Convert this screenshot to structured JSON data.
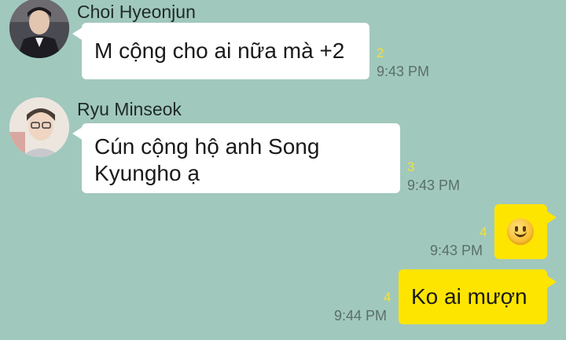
{
  "messages": [
    {
      "sender": "Choi Hyeonjun",
      "text": "M cộng cho ai nữa mà +2",
      "unread": "2",
      "time": "9:43 PM",
      "avatar": "avatar-choi-hyeonjun"
    },
    {
      "sender": "Ryu Minseok",
      "text_line1": "Cún cộng hộ anh Song",
      "text_line2": "Kyungho ạ",
      "unread": "3",
      "time": "9:43 PM",
      "avatar": "avatar-ryu-minseok"
    },
    {
      "sender": "me",
      "emoji": "slightly-smiling-face-icon",
      "unread": "4",
      "time": "9:43 PM"
    },
    {
      "sender": "me",
      "text": "Ko ai mượn",
      "unread": "4",
      "time": "9:44 PM"
    }
  ],
  "colors": {
    "background": "#a1c8bd",
    "incoming_bubble": "#ffffff",
    "outgoing_bubble": "#fee500",
    "unread_count": "#f3e03f"
  }
}
